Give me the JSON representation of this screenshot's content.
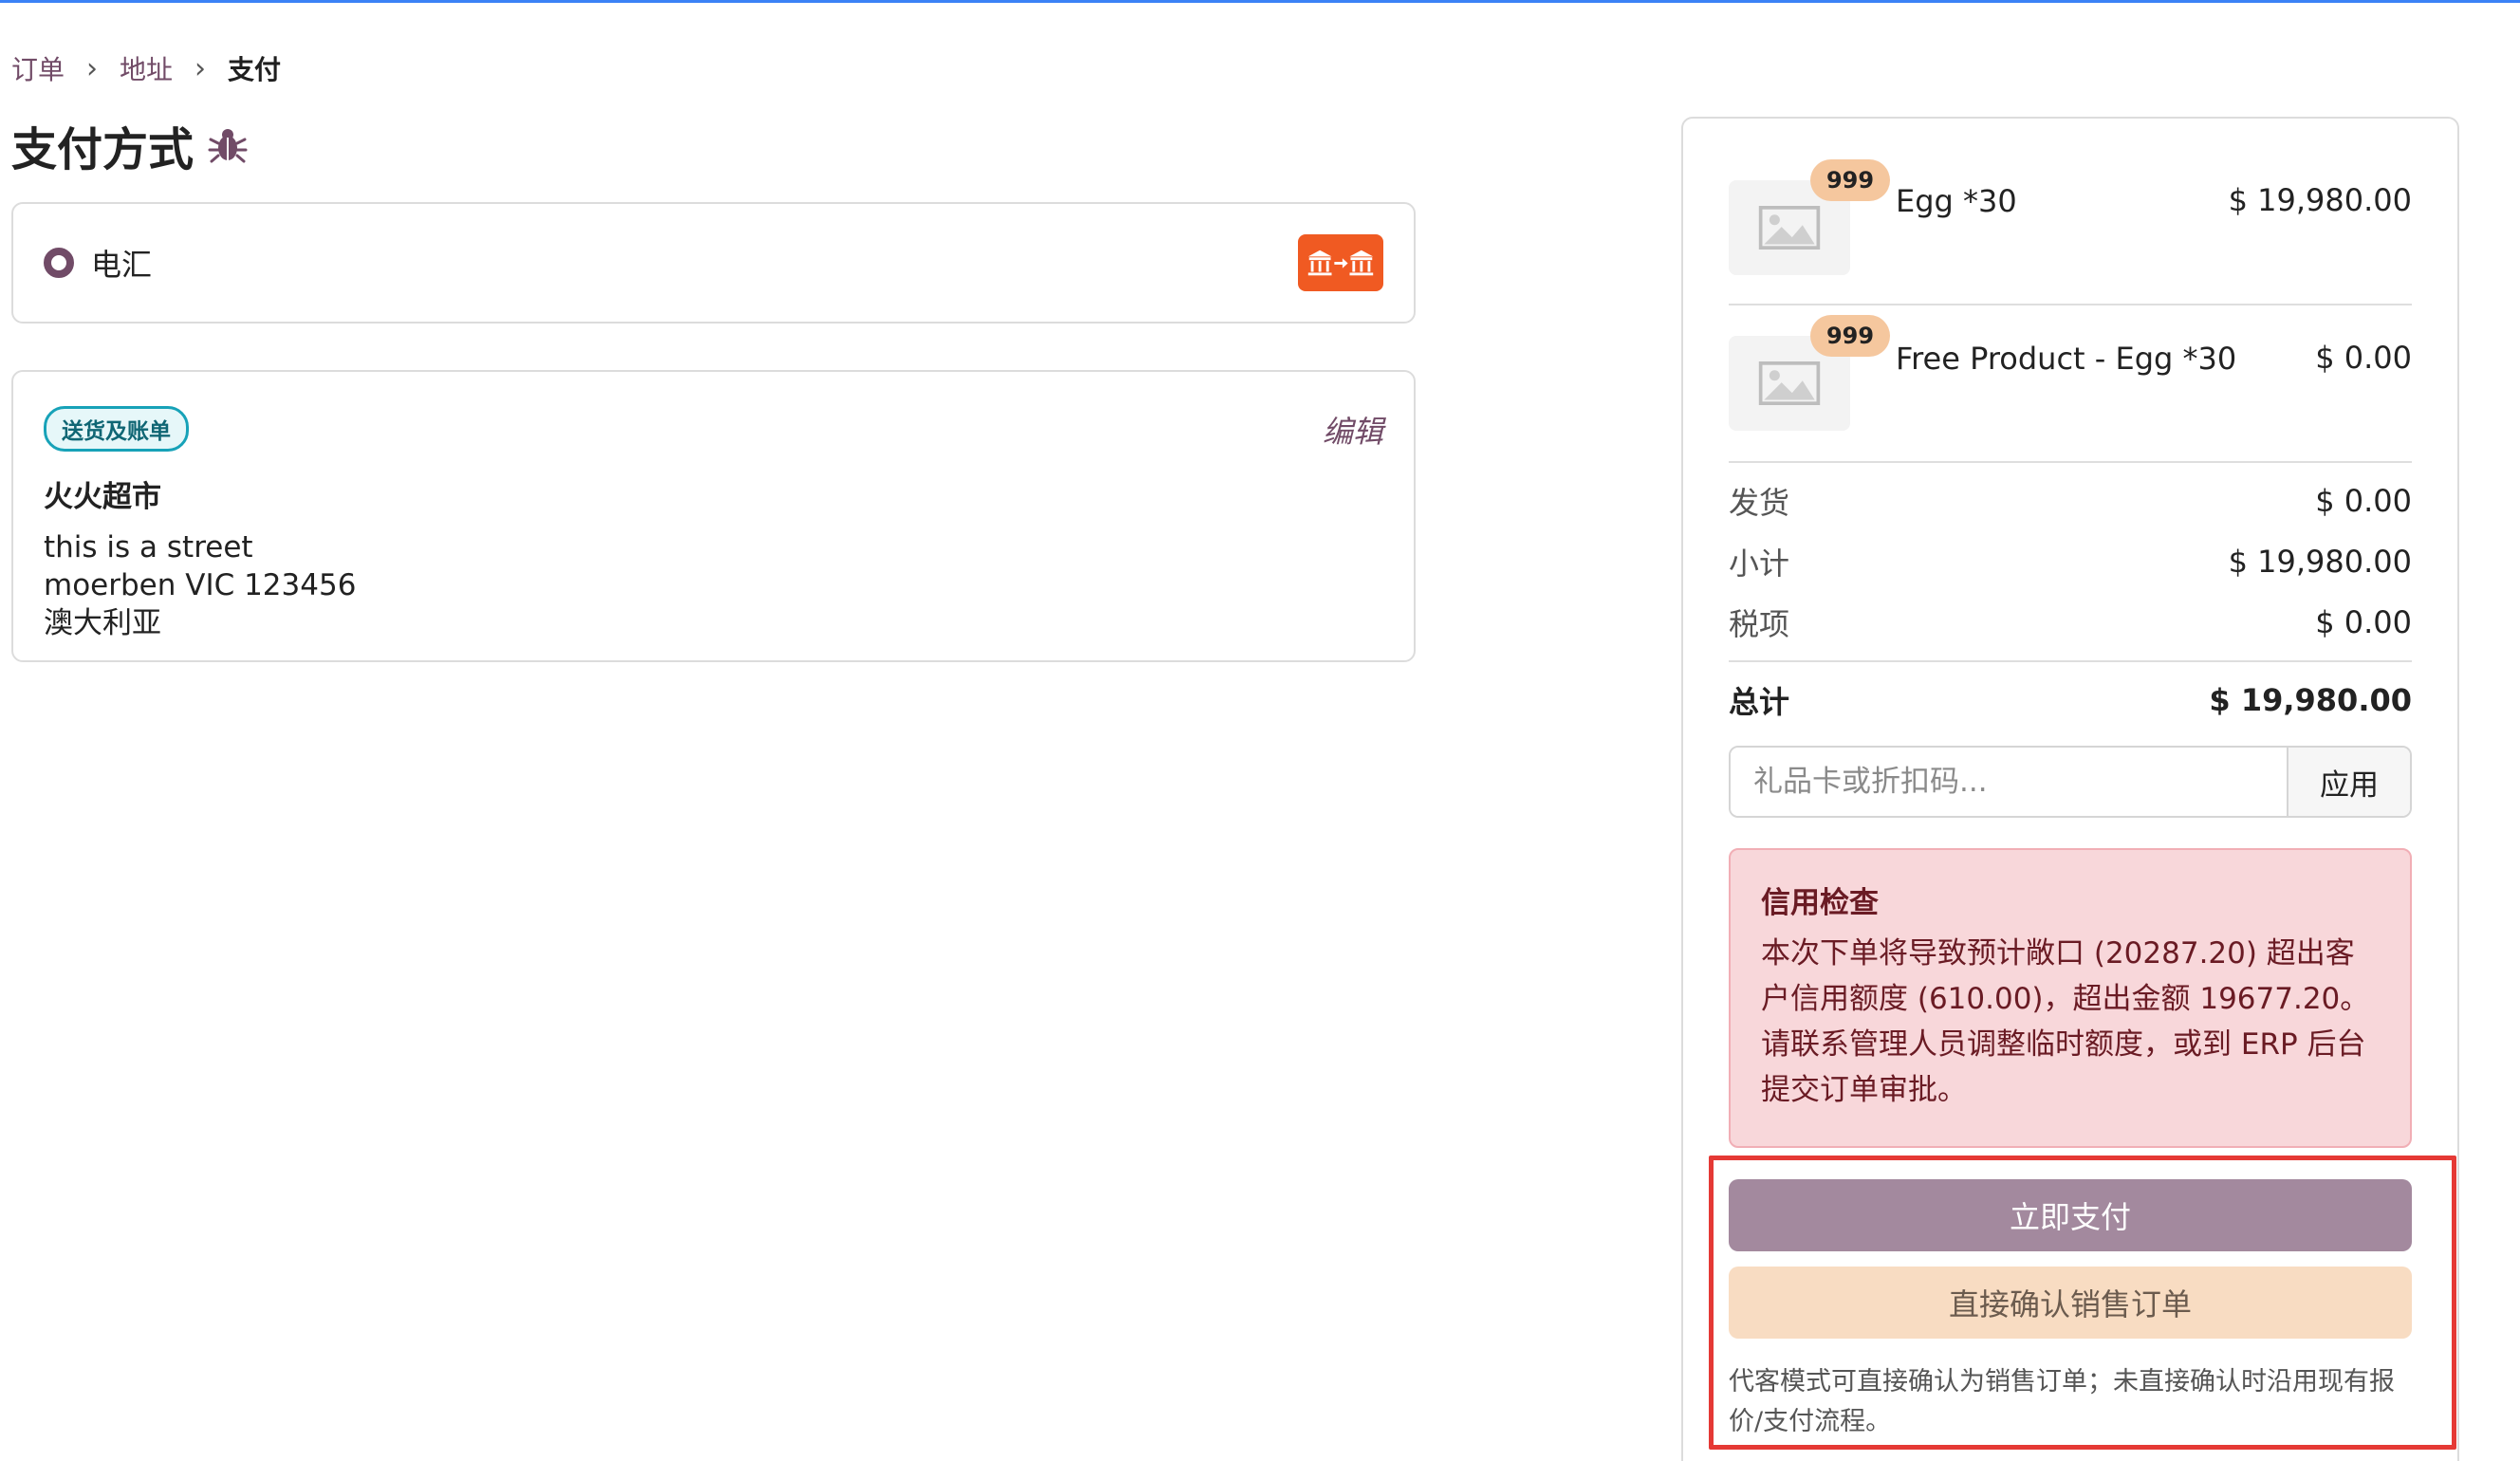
{
  "breadcrumb": {
    "items": [
      "订单",
      "地址",
      "支付"
    ]
  },
  "page": {
    "title": "支付方式"
  },
  "payment": {
    "method_label": "电汇"
  },
  "address": {
    "badge": "送货及账单",
    "edit_label": "编辑",
    "name": "火火超市",
    "lines": [
      "this is a street",
      "moerben VIC 123456",
      "澳大利亚"
    ]
  },
  "summary": {
    "products": [
      {
        "qty": "999",
        "name": "Egg *30",
        "price": "$ 19,980.00"
      },
      {
        "qty": "999",
        "name": "Free Product - Egg *30",
        "price": "$ 0.00"
      }
    ],
    "shipping": {
      "label": "发货",
      "value": "$ 0.00"
    },
    "subtotal": {
      "label": "小计",
      "value": "$ 19,980.00"
    },
    "tax": {
      "label": "税项",
      "value": "$ 0.00"
    },
    "total": {
      "label": "总计",
      "value": "$ 19,980.00"
    },
    "promo": {
      "placeholder": "礼品卡或折扣码...",
      "apply_label": "应用"
    }
  },
  "alert": {
    "title": "信用检查",
    "body": "本次下单将导致预计敞口 (20287.20) 超出客户信用额度 (610.00)，超出金额 19677.20。请联系管理人员调整临时额度，或到 ERP 后台提交订单审批。"
  },
  "actions": {
    "pay_now": "立即支付",
    "confirm_order": "直接确认销售订单",
    "note": "代客模式可直接确认为销售订单；未直接确认时沿用现有报价/支付流程。"
  },
  "colors": {
    "brand": "#714b67",
    "pay_button": "#a3899e",
    "confirm_button": "#f8dcc2",
    "alert_bg": "#f8d7da",
    "bank_badge": "#f05a22",
    "highlight": "#e53935"
  }
}
